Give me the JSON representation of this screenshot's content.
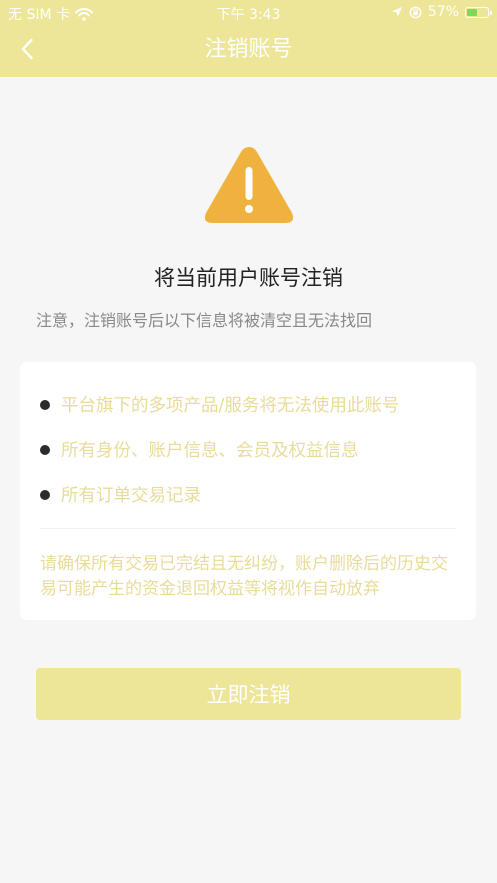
{
  "status_bar": {
    "carrier": "无 SIM 卡",
    "time": "下午 3:43",
    "battery_percent": "57%",
    "battery_level": 0.57
  },
  "nav": {
    "title": "注销账号",
    "back_icon": "chevron-left-icon"
  },
  "content": {
    "warning_icon": "warning-triangle-icon",
    "title": "将当前用户账号注销",
    "notice": "注意，注销账号后以下信息将被清空且无法找回",
    "items": [
      "平台旗下的多项产品/服务将无法使用此账号",
      "所有身份、账户信息、会员及权益信息",
      "所有订单交易记录"
    ],
    "warning_text": "请确保所有交易已完结且无纠纷，账户删除后的历史交易可能产生的资金退回权益等将视作自动放弃"
  },
  "action": {
    "label": "立即注销"
  },
  "colors": {
    "header_bg": "#ede598",
    "page_bg": "#f6f6f6",
    "accent_text": "#e8dc9a",
    "warning_icon": "#f0b23f",
    "battery_fill": "#7ed957"
  }
}
